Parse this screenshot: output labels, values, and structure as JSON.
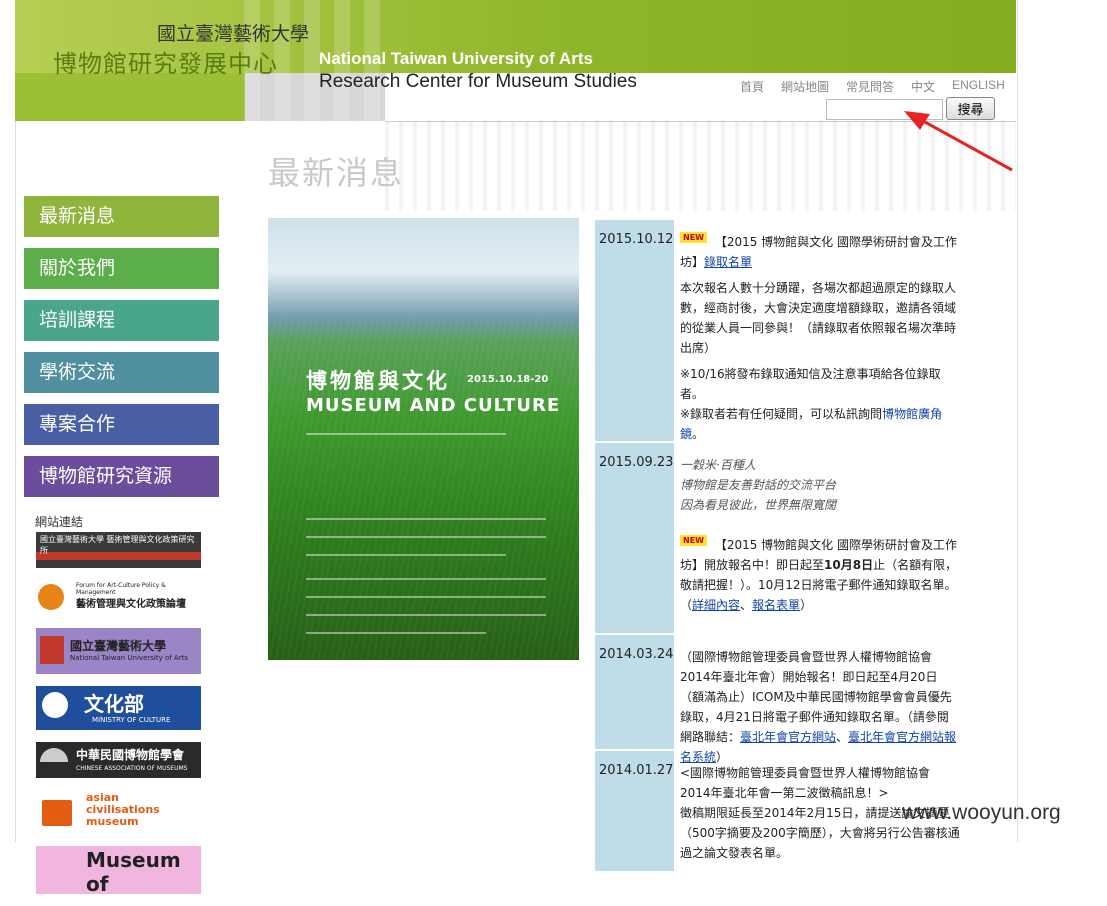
{
  "header": {
    "school_cn": "國立臺灣藝術大學",
    "center_cn": "博物館研究發展中心",
    "en_line1": "National Taiwan  University of Arts",
    "en_line2": "Research Center for Museum Studies"
  },
  "topnav": [
    "首頁",
    "網站地圖",
    "常見問答",
    "中文",
    "ENGLISH"
  ],
  "search": {
    "value": "",
    "button": "搜尋"
  },
  "page_title": "最新消息",
  "menu": [
    {
      "label": "最新消息",
      "color": "#8fb53c"
    },
    {
      "label": "關於我們",
      "color": "#5bae4a"
    },
    {
      "label": "培訓課程",
      "color": "#4aa68a"
    },
    {
      "label": "學術交流",
      "color": "#4f8fa0"
    },
    {
      "label": "專案合作",
      "color": "#4a5fa3"
    },
    {
      "label": "博物館研究資源",
      "color": "#6a4e9c"
    }
  ],
  "links_title": "網站連結",
  "links": [
    {
      "text": "國立臺灣藝術大學 藝術管理與文化政策研究所",
      "bg": "#3a3a3a",
      "fg": "#fff"
    },
    {
      "text": "藝術管理與文化政策論壇",
      "sub": "Forum for Art-Culture Policy & Management",
      "bg": "#ffffff",
      "fg": "#222"
    },
    {
      "text": "國立臺灣藝術大學",
      "sub": "National Taiwan University of Arts",
      "bg": "#9a85c6",
      "fg": "#222"
    },
    {
      "text": "文化部",
      "sub": "MINISTRY OF CULTURE",
      "bg": "#1f4e9c",
      "fg": "#fff"
    },
    {
      "text": "中華民國博物館學會",
      "sub": "CHINESE ASSOCIATION OF MUSEUMS",
      "bg": "#2a2a2a",
      "fg": "#fff"
    },
    {
      "text": "asian civilisations museum",
      "bg": "#ffffff",
      "fg": "#e25d12"
    },
    {
      "text": "Museum of Liverpool",
      "bg": "#f0b6e0",
      "fg": "#222"
    }
  ],
  "poster": {
    "title_cn": "博物館與文化",
    "date": "2015.10.18-20",
    "title_en": "MUSEUM AND CULTURE"
  },
  "news": [
    {
      "date": "2015.10.12",
      "is_new": true,
      "new_label": "NEW",
      "headline": "【2015 博物館與文化 國際學術研討會及工作坊】",
      "headline_link": "錄取名單",
      "p1": "本次報名人數十分踴躍，各場次都超過原定的錄取人數，經商討後，大會決定適度增額錄取，邀請各領域的從業人員一同參與！（請錄取者依照報名場次準時出席）",
      "p2": "※10/16將發布錄取通知信及注意事項給各位錄取者。",
      "p3": "※錄取者若有任何疑問，可以私訊詢問",
      "p3_link": "博物館廣角鏡",
      "p3_end": "。"
    },
    {
      "date": "2015.09.23",
      "italic1": "一穀米·百種人",
      "italic2": "博物館是友善對話的交流平台",
      "italic3": "因為看見彼此，世界無限寬闊",
      "is_new": true,
      "new_label": "NEW",
      "headline": "【2015 博物館與文化 國際學術研討會及工作坊】開放報名中！即日起至",
      "headline_bold": "10月8日",
      "headline_end": "止（名額有限，敬請把握！）。10月12日將電子郵件通知錄取名單。",
      "links_open": "（",
      "link1": "詳細內容",
      "sep": "、",
      "link2": "報名表單",
      "links_close": "）"
    },
    {
      "date": "2014.03.24",
      "text": "（國際博物館管理委員會暨世界人權博物館協會2014年臺北年會）開始報名！即日起至4月20日（額滿為止）ICOM及中華民國博物館學會會員優先錄取，4月21日將電子郵件通知錄取名單。（請參閱網路聯結：",
      "link1": "臺北年會官方網站",
      "sep": "、",
      "link2": "臺北年會官方網站報名系統",
      "close": "）"
    },
    {
      "date": "2014.01.27",
      "text1": "<國際博物館管理委員會暨世界人權博物館協會2014年臺北年會一第二波徵稿訊息！>",
      "text2": "徵稿期限延長至2014年2月15日，請提送論文摘要（500字摘要及200字簡歷），大會將另行公告審核通過之論文發表名單。"
    }
  ],
  "watermark": "www.wooyun.org"
}
